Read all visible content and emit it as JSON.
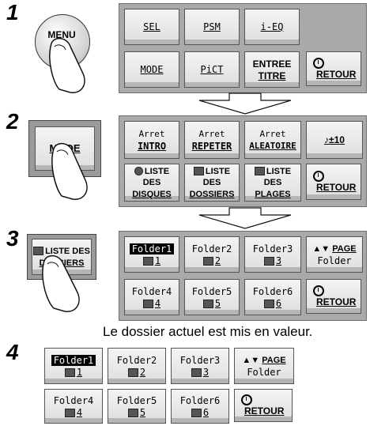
{
  "steps": [
    "1",
    "2",
    "3",
    "4"
  ],
  "menu_button": {
    "label": "MENU"
  },
  "mode_key": {
    "label": "MODE"
  },
  "dossiers_key": {
    "line1": "LISTE DES",
    "line2": "DOSSIERS"
  },
  "panel1": {
    "buttons": [
      "SEL",
      "PSM",
      "i-EQ",
      "MODE",
      "PiCT"
    ],
    "entree": {
      "line1": "ENTREE",
      "line2": "TITRE"
    },
    "retour": "RETOUR"
  },
  "panel2": {
    "intro": {
      "line1": "Arret",
      "line2": "INTRO"
    },
    "repeter": {
      "line1": "Arret",
      "line2": "REPETER"
    },
    "aleatoire": {
      "line1": "Arret",
      "line2": "ALEATOIRE"
    },
    "volume": "♪±10",
    "disques": {
      "line1": "LISTE DES",
      "line2": "DISQUES"
    },
    "dossiers": {
      "line1": "LISTE DES",
      "line2": "DOSSIERS"
    },
    "plages": {
      "line1": "LISTE DES",
      "line2": "PLAGES"
    },
    "retour": "RETOUR"
  },
  "panel3": {
    "folders": [
      {
        "name": "Folder1",
        "num": "1"
      },
      {
        "name": "Folder2",
        "num": "2"
      },
      {
        "name": "Folder3",
        "num": "3"
      },
      {
        "name": "Folder4",
        "num": "4"
      },
      {
        "name": "Folder5",
        "num": "5"
      },
      {
        "name": "Folder6",
        "num": "6"
      }
    ],
    "page": "PAGE",
    "folder_label": "Folder",
    "retour": "RETOUR"
  },
  "caption": "Le dossier actuel est mis en valeur.",
  "panel4": {
    "folders": [
      {
        "name": "Folder1",
        "num": "1"
      },
      {
        "name": "Folder2",
        "num": "2"
      },
      {
        "name": "Folder3",
        "num": "3"
      },
      {
        "name": "Folder4",
        "num": "4"
      },
      {
        "name": "Folder5",
        "num": "5"
      },
      {
        "name": "Folder6",
        "num": "6"
      }
    ],
    "page": "PAGE",
    "folder_label": "Folder",
    "retour": "RETOUR"
  }
}
